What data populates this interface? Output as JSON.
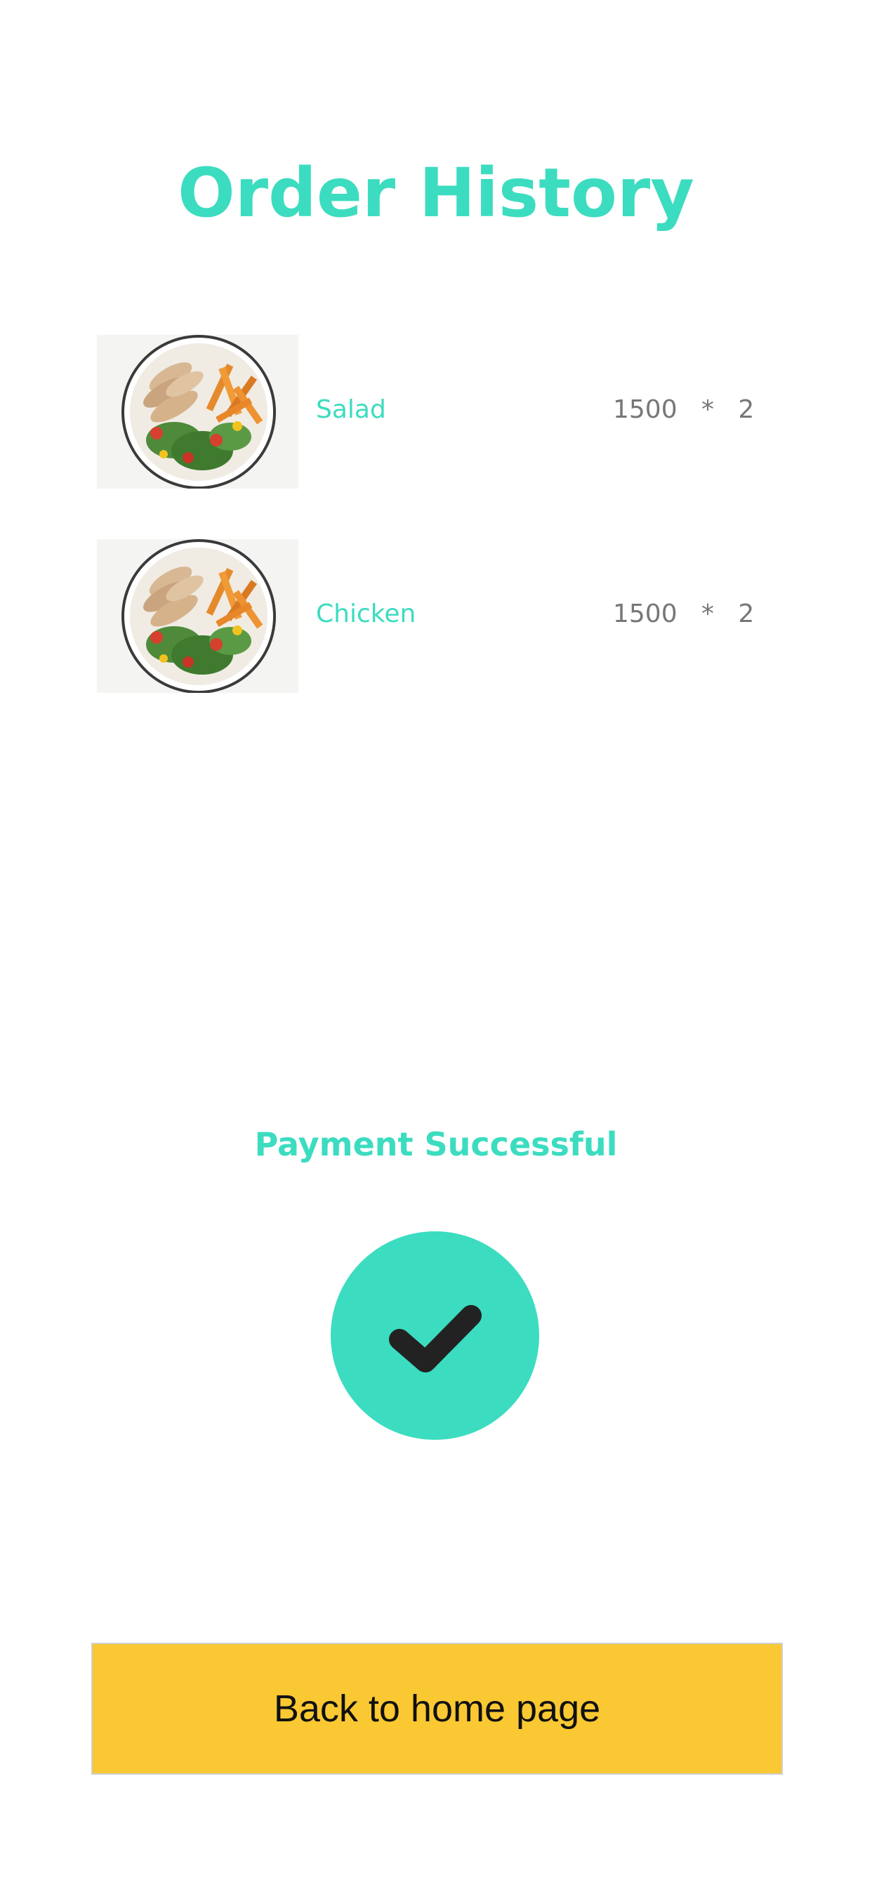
{
  "header": {
    "title": "Order History"
  },
  "orders": [
    {
      "name": "Salad",
      "price": "1500",
      "separator": "*",
      "quantity": "2",
      "image_icon": "food-plate-icon"
    },
    {
      "name": "Chicken",
      "price": "1500",
      "separator": "*",
      "quantity": "2",
      "image_icon": "food-plate-icon"
    }
  ],
  "payment": {
    "status_text": "Payment Successful",
    "status_icon": "checkmark-icon"
  },
  "footer": {
    "button_label": "Back to home page"
  },
  "colors": {
    "accent": "#3cdcc0",
    "button": "#f9c832",
    "muted_text": "#777777",
    "check": "#222222"
  }
}
